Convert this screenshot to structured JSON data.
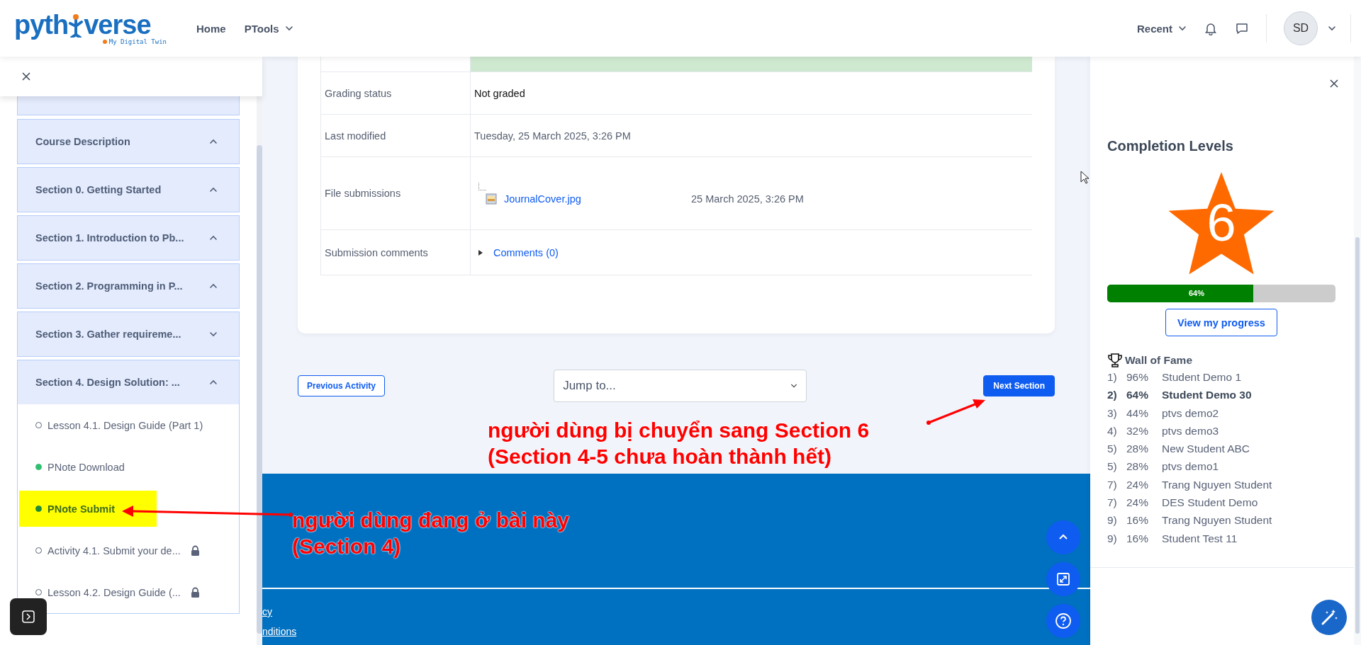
{
  "header": {
    "logo": {
      "left": "pyth",
      "right": "verse",
      "tagline": "My Digital Twin"
    },
    "nav": [
      {
        "label": "Home",
        "dropdown": false
      },
      {
        "label": "PTools",
        "dropdown": true
      }
    ],
    "recent": {
      "label": "Recent"
    },
    "avatar": {
      "initials": "SD"
    }
  },
  "course_index": {
    "sections": [
      {
        "title": "Course Description",
        "expanded": true
      },
      {
        "title": "Section 0. Getting Started",
        "expanded": true
      },
      {
        "title": "Section 1. Introduction to Pb...",
        "expanded": true
      },
      {
        "title": "Section 2. Programming in P...",
        "expanded": true
      },
      {
        "title": "Section 3. Gather requireme...",
        "expanded": false
      },
      {
        "title": "Section 4. Design Solution: ...",
        "expanded": true,
        "children": [
          {
            "title": "Lesson 4.1. Design Guide (Part 1)",
            "complete": false,
            "locked": false,
            "current": false,
            "highlighted": false
          },
          {
            "title": "PNote Download",
            "complete": true,
            "locked": false,
            "current": false,
            "highlighted": false
          },
          {
            "title": "PNote Submit",
            "complete": true,
            "locked": false,
            "current": true,
            "highlighted": true
          },
          {
            "title": "Activity 4.1. Submit your de...",
            "complete": false,
            "locked": true,
            "current": false,
            "highlighted": false
          },
          {
            "title": "Lesson 4.2. Design Guide (...",
            "complete": false,
            "locked": true,
            "current": false,
            "highlighted": false
          }
        ]
      }
    ]
  },
  "submission_table": {
    "rows": [
      {
        "kind": "text",
        "label": "Grading status",
        "value": "Not graded",
        "strong": true
      },
      {
        "kind": "text",
        "label": "Last modified",
        "value": "Tuesday, 25 March 2025, 3:26 PM",
        "strong": false
      },
      {
        "kind": "file",
        "label": "File submissions",
        "file": "JournalCover.jpg",
        "date": "25 March 2025, 3:26 PM"
      },
      {
        "kind": "comments",
        "label": "Submission comments",
        "link": "Comments (0)"
      }
    ]
  },
  "navigation": {
    "previous": "Previous Activity",
    "jump": {
      "placeholder": "Jump to..."
    },
    "next": "Next Section"
  },
  "footer": {
    "links": [
      "cy",
      "nditions"
    ]
  },
  "completion": {
    "title": "Completion Levels",
    "level_badge": "6",
    "progress": {
      "level": 0.64,
      "label": "64%"
    },
    "button": "View my progress",
    "wall_title": "Wall of Fame",
    "entries": [
      {
        "rank": "1)",
        "percent": "96%",
        "name": "Student Demo 1",
        "current": false
      },
      {
        "rank": "2)",
        "percent": "64%",
        "name": "Student Demo 30",
        "current": true
      },
      {
        "rank": "3)",
        "percent": "44%",
        "name": "ptvs demo2",
        "current": false
      },
      {
        "rank": "4)",
        "percent": "32%",
        "name": "ptvs demo3",
        "current": false
      },
      {
        "rank": "5)",
        "percent": "28%",
        "name": "New Student ABC",
        "current": false
      },
      {
        "rank": "5)",
        "percent": "28%",
        "name": "ptvs demo1",
        "current": false
      },
      {
        "rank": "7)",
        "percent": "24%",
        "name": "Trang Nguyen Student",
        "current": false
      },
      {
        "rank": "7)",
        "percent": "24%",
        "name": "DES Student Demo",
        "current": false
      },
      {
        "rank": "9)",
        "percent": "16%",
        "name": "Trang Nguyen Student",
        "current": false
      },
      {
        "rank": "9)",
        "percent": "16%",
        "name": "Student Test 11",
        "current": false
      }
    ]
  },
  "annotations": [
    {
      "lines": [
        "người dùng bị chuyển sang Section 6",
        "(Section 4-5 chưa hoàn thành hết)"
      ],
      "kind": "pointer"
    },
    {
      "lines": [
        "người dùng đang ở bài này",
        "(Section 4)"
      ],
      "kind": "pointer"
    }
  ]
}
